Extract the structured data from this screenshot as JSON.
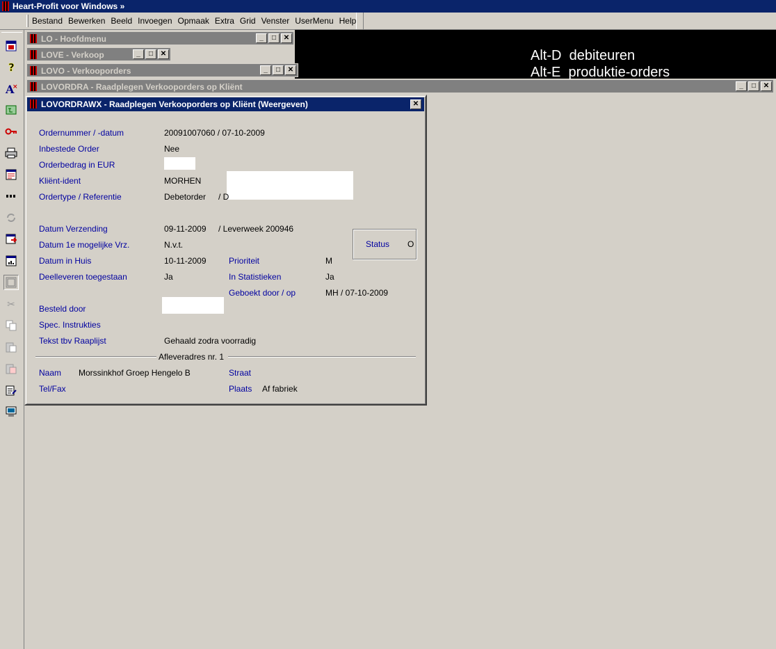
{
  "app": {
    "title": "Heart-Profit voor Windows  »"
  },
  "menu": [
    "Bestand",
    "Bewerken",
    "Beeld",
    "Invoegen",
    "Opmaak",
    "Extra",
    "Grid",
    "Venster",
    "UserMenu",
    "Help"
  ],
  "toolbar": [
    "window-icon",
    "help-icon",
    "font-icon",
    "tree-icon",
    "key-icon",
    "print-icon",
    "form-icon",
    "dots-icon",
    "refresh-icon",
    "export-icon",
    "chart-icon",
    "window-frame-icon",
    "cut-icon",
    "copy-icon",
    "paste-icon",
    "paste-special-icon",
    "clipboard-edit-icon",
    "monitor-icon"
  ],
  "hotkeys": [
    {
      "key": "Alt-D",
      "label": "debiteuren"
    },
    {
      "key": "Alt-E",
      "label": "produktie-orders"
    }
  ],
  "windows": {
    "lo": "LO - Hoofdmenu",
    "love": "LOVE - Verkoop",
    "lovo": "LOVO - Verkooporders",
    "lovordra": "LOVORDRA - Raadplegen Verkooporders op Kliënt"
  },
  "dialog": {
    "title": "LOVORDRAWX - Raadplegen Verkooporders op Kliënt (Weergeven)",
    "fields": {
      "ordernummer_label": "Ordernummer / -datum",
      "ordernummer_value": "20091007060 / 07-10-2009",
      "inbestede_label": "Inbestede Order",
      "inbestede_value": "Nee",
      "orderbedrag_label": "Orderbedrag in EUR",
      "klient_label": "Kliënt-ident",
      "klient_value": "MORHEN",
      "ordertype_label": "Ordertype / Referentie",
      "ordertype_value": "Debetorder",
      "ordertype_sep": "/ D",
      "datum_verzending_label": "Datum Verzending",
      "datum_verzending_value": "09-11-2009",
      "leverweek_value": "/ Leverweek 200946",
      "datum_1e_label": "Datum 1e mogelijke Vrz.",
      "datum_1e_value": "N.v.t.",
      "datum_huis_label": "Datum in Huis",
      "datum_huis_value": "10-11-2009",
      "prioriteit_label": "Prioriteit",
      "prioriteit_value": "M",
      "deelleveren_label": "Deelleveren toegestaan",
      "deelleveren_value": "Ja",
      "statistieken_label": "In Statistieken",
      "statistieken_value": "Ja",
      "geboekt_label": "Geboekt door / op",
      "geboekt_value": "MH / 07-10-2009",
      "status_label": "Status",
      "status_value": "O",
      "besteld_label": "Besteld door",
      "spec_label": "Spec. Instrukties",
      "tekst_label": "Tekst tbv Raaplijst",
      "tekst_value": "Gehaald zodra voorradig"
    },
    "aflever": {
      "heading": "Afleveradres nr. 1",
      "naam_label": "Naam",
      "naam_value": "Morssinkhof Groep Hengelo B",
      "straat_label": "Straat",
      "telfax_label": "Tel/Fax",
      "plaats_label": "Plaats",
      "plaats_value": "Af fabriek"
    }
  }
}
